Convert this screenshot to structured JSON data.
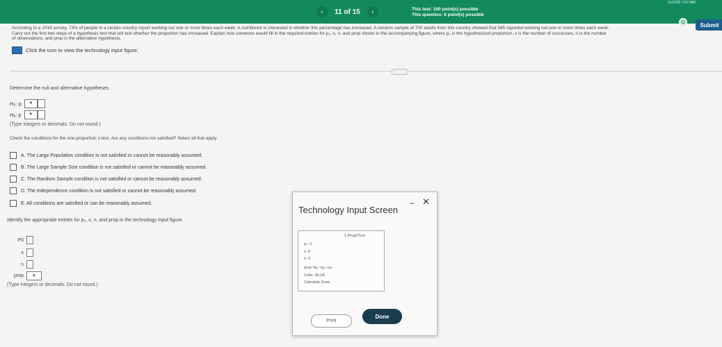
{
  "header": {
    "prev": "‹",
    "counter": "11 of 15",
    "next": "›",
    "test_points": "This test: 100 point(s) possible",
    "question_points": "This question: 6 point(s) possible",
    "submit": "Submit",
    "time": "11/2/25 7:57 AM"
  },
  "problem": {
    "line1": "According to a 2018 survey, 73% of people in a certain country report working out one or more times each week. A nutritionist is interested in whether this percentage has increased. A random sample of 700 adults from this country showed that 565 reported working out one or more times each week.",
    "line2": "Carry out the first two steps of a hypothesis test that will test whether the proportion has increased. Explain how someone would fill in the required entries for p₀, x, n, and prop shown in the accompanying figure, where p₀ is the hypothesized proportion, x is the number of successes, n is the number",
    "line3": "of observations, and prop is the alternative hypothesis.",
    "link": "Click the icon to view the technology input figure."
  },
  "q1": {
    "text": "Determine the null and alternative hypotheses.",
    "h0_label": "H₀: p",
    "ha_label": "Hₐ: p",
    "dd_symbol": "▼",
    "note": "(Type integers or decimals. Do not round.)"
  },
  "q2": {
    "text": "Check the conditions for the one-proportion z-test. Are any conditions not satisfied? Select all that apply.",
    "options": [
      "A.  The Large Population condition is not satisfied or cannot be reasonably assumed.",
      "B.  The Large Sample Size condition is not satisfied or cannot be reasonably assumed.",
      "C.  The Random Sample condition is not satisfied or cannot be reasonably assumed.",
      "D.  The Independence condition is not satisfied or cannot be reasonably assumed.",
      "E.  All conditions are satisfied or can be reasonably assumed."
    ]
  },
  "q3": {
    "text": "Identify the appropriate entries for p₀, x, n, and prop in the technology input figure.",
    "p0": "P0",
    "x": "x",
    "n": "n",
    "prop": "prop",
    "note": "(Type integers or decimals. Do not round.)"
  },
  "modal": {
    "title": "Technology Input Screen",
    "minimize": "–",
    "close": "✕",
    "calc_title": "1-PropZTest",
    "lines": [
      "p₀: 0",
      "x: 0",
      "n: 0",
      "prop ≠p₀  <p₀  >p₀",
      "Color: BLUE",
      "Calculate  Draw"
    ],
    "print": "Print",
    "done": "Done",
    "cursor": "↖"
  }
}
